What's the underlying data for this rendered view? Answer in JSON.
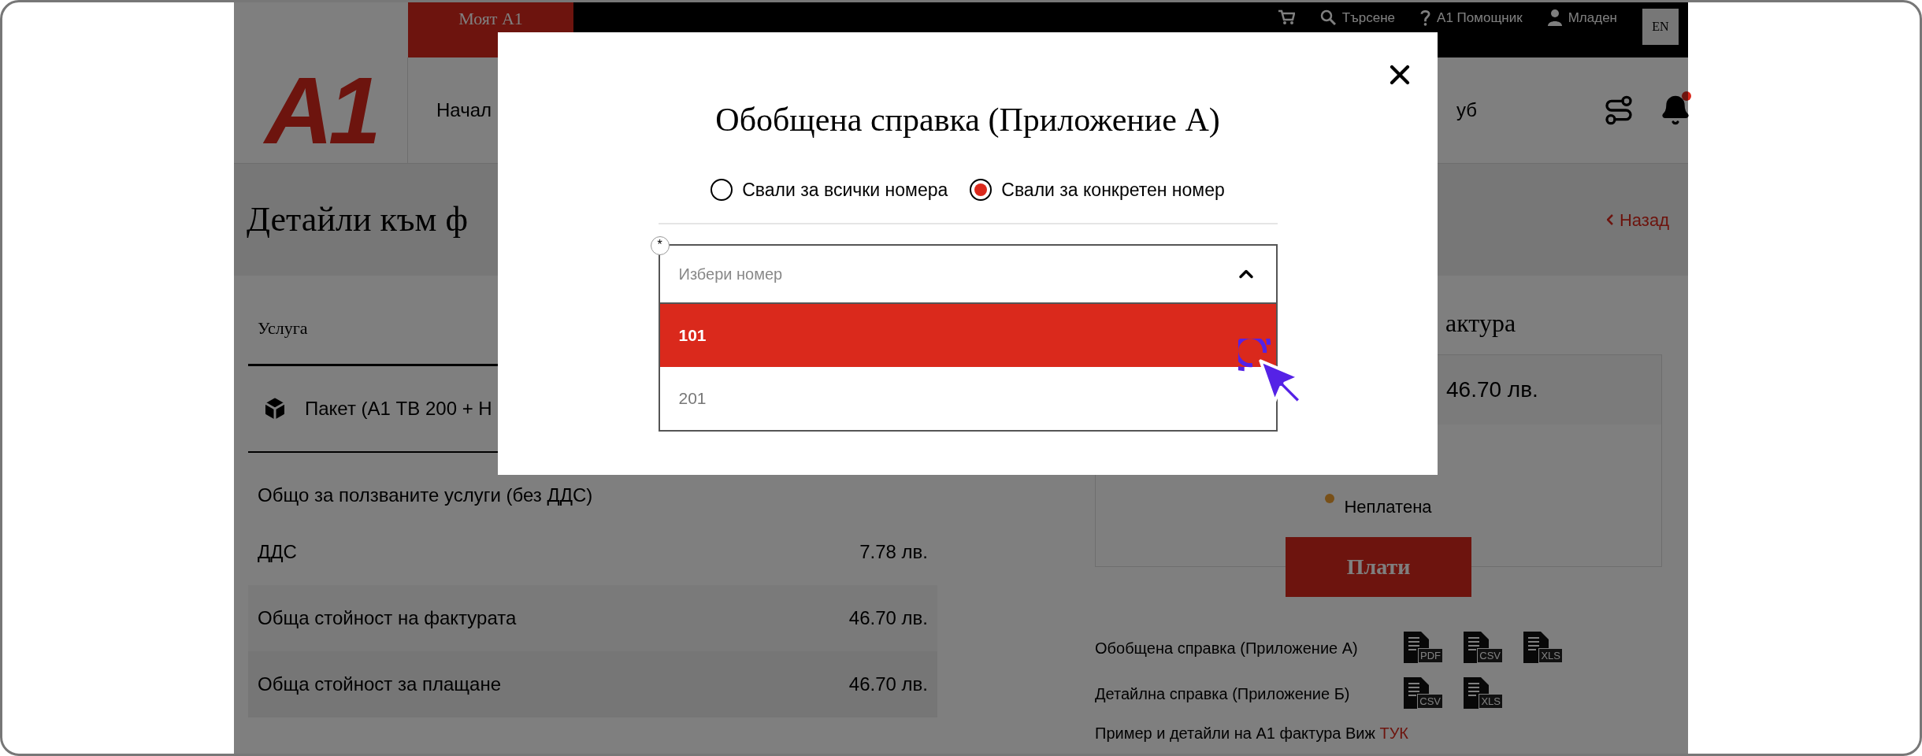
{
  "header": {
    "tab": "Моят А1",
    "top_links": [
      {
        "kind": "cart"
      },
      {
        "kind": "search",
        "label": "Търсене"
      },
      {
        "kind": "help",
        "label": "А1 Помощник"
      },
      {
        "kind": "user",
        "label": "Младен"
      }
    ],
    "language": "EN",
    "logo": "A1",
    "nav": [
      "Начал",
      "уб"
    ]
  },
  "title_bar": {
    "title": "Детайли към ф",
    "back": "Назад"
  },
  "table": {
    "column_1": "Услуга",
    "package": "Пакет (А1 ТВ 200 + Н",
    "rows": [
      {
        "kind": "plain",
        "label": "Общо за ползваните услуги (без ДДС)"
      },
      {
        "kind": "plain",
        "label": "ДДС",
        "amount": "7.78 лв."
      },
      {
        "kind": "total",
        "label": "Обща стойност на фактурата",
        "amount": "46.70 лв."
      },
      {
        "kind": "due",
        "label": "Обща стойност за плащане",
        "amount": "46.70 лв."
      }
    ]
  },
  "invoice": {
    "heading": "актура",
    "amount": "46.70 лв.",
    "status": "Неплатена",
    "pay_button": "Плати",
    "reports": [
      {
        "label": "Обобщена справка (Приложение А)",
        "formats": [
          "PDF",
          "CSV",
          "XLS"
        ]
      },
      {
        "label": "Детайлна справка (Приложение Б)",
        "formats": [
          "CSV",
          "XLS"
        ]
      }
    ],
    "example": {
      "text": "Пример и детайли на А1 фактура Виж",
      "link": "ТУК"
    }
  },
  "modal": {
    "title": "Обобщена справка (Приложение А)",
    "radios": [
      {
        "label": "Свали за всички номера",
        "selected": false
      },
      {
        "label": "Свали за конкретен номер",
        "selected": true
      }
    ],
    "select": {
      "required_mark": "*",
      "placeholder": "Избери номер",
      "expanded": true,
      "options": [
        {
          "label": "101",
          "selected": true
        },
        {
          "label": "201",
          "selected": false
        }
      ]
    }
  }
}
